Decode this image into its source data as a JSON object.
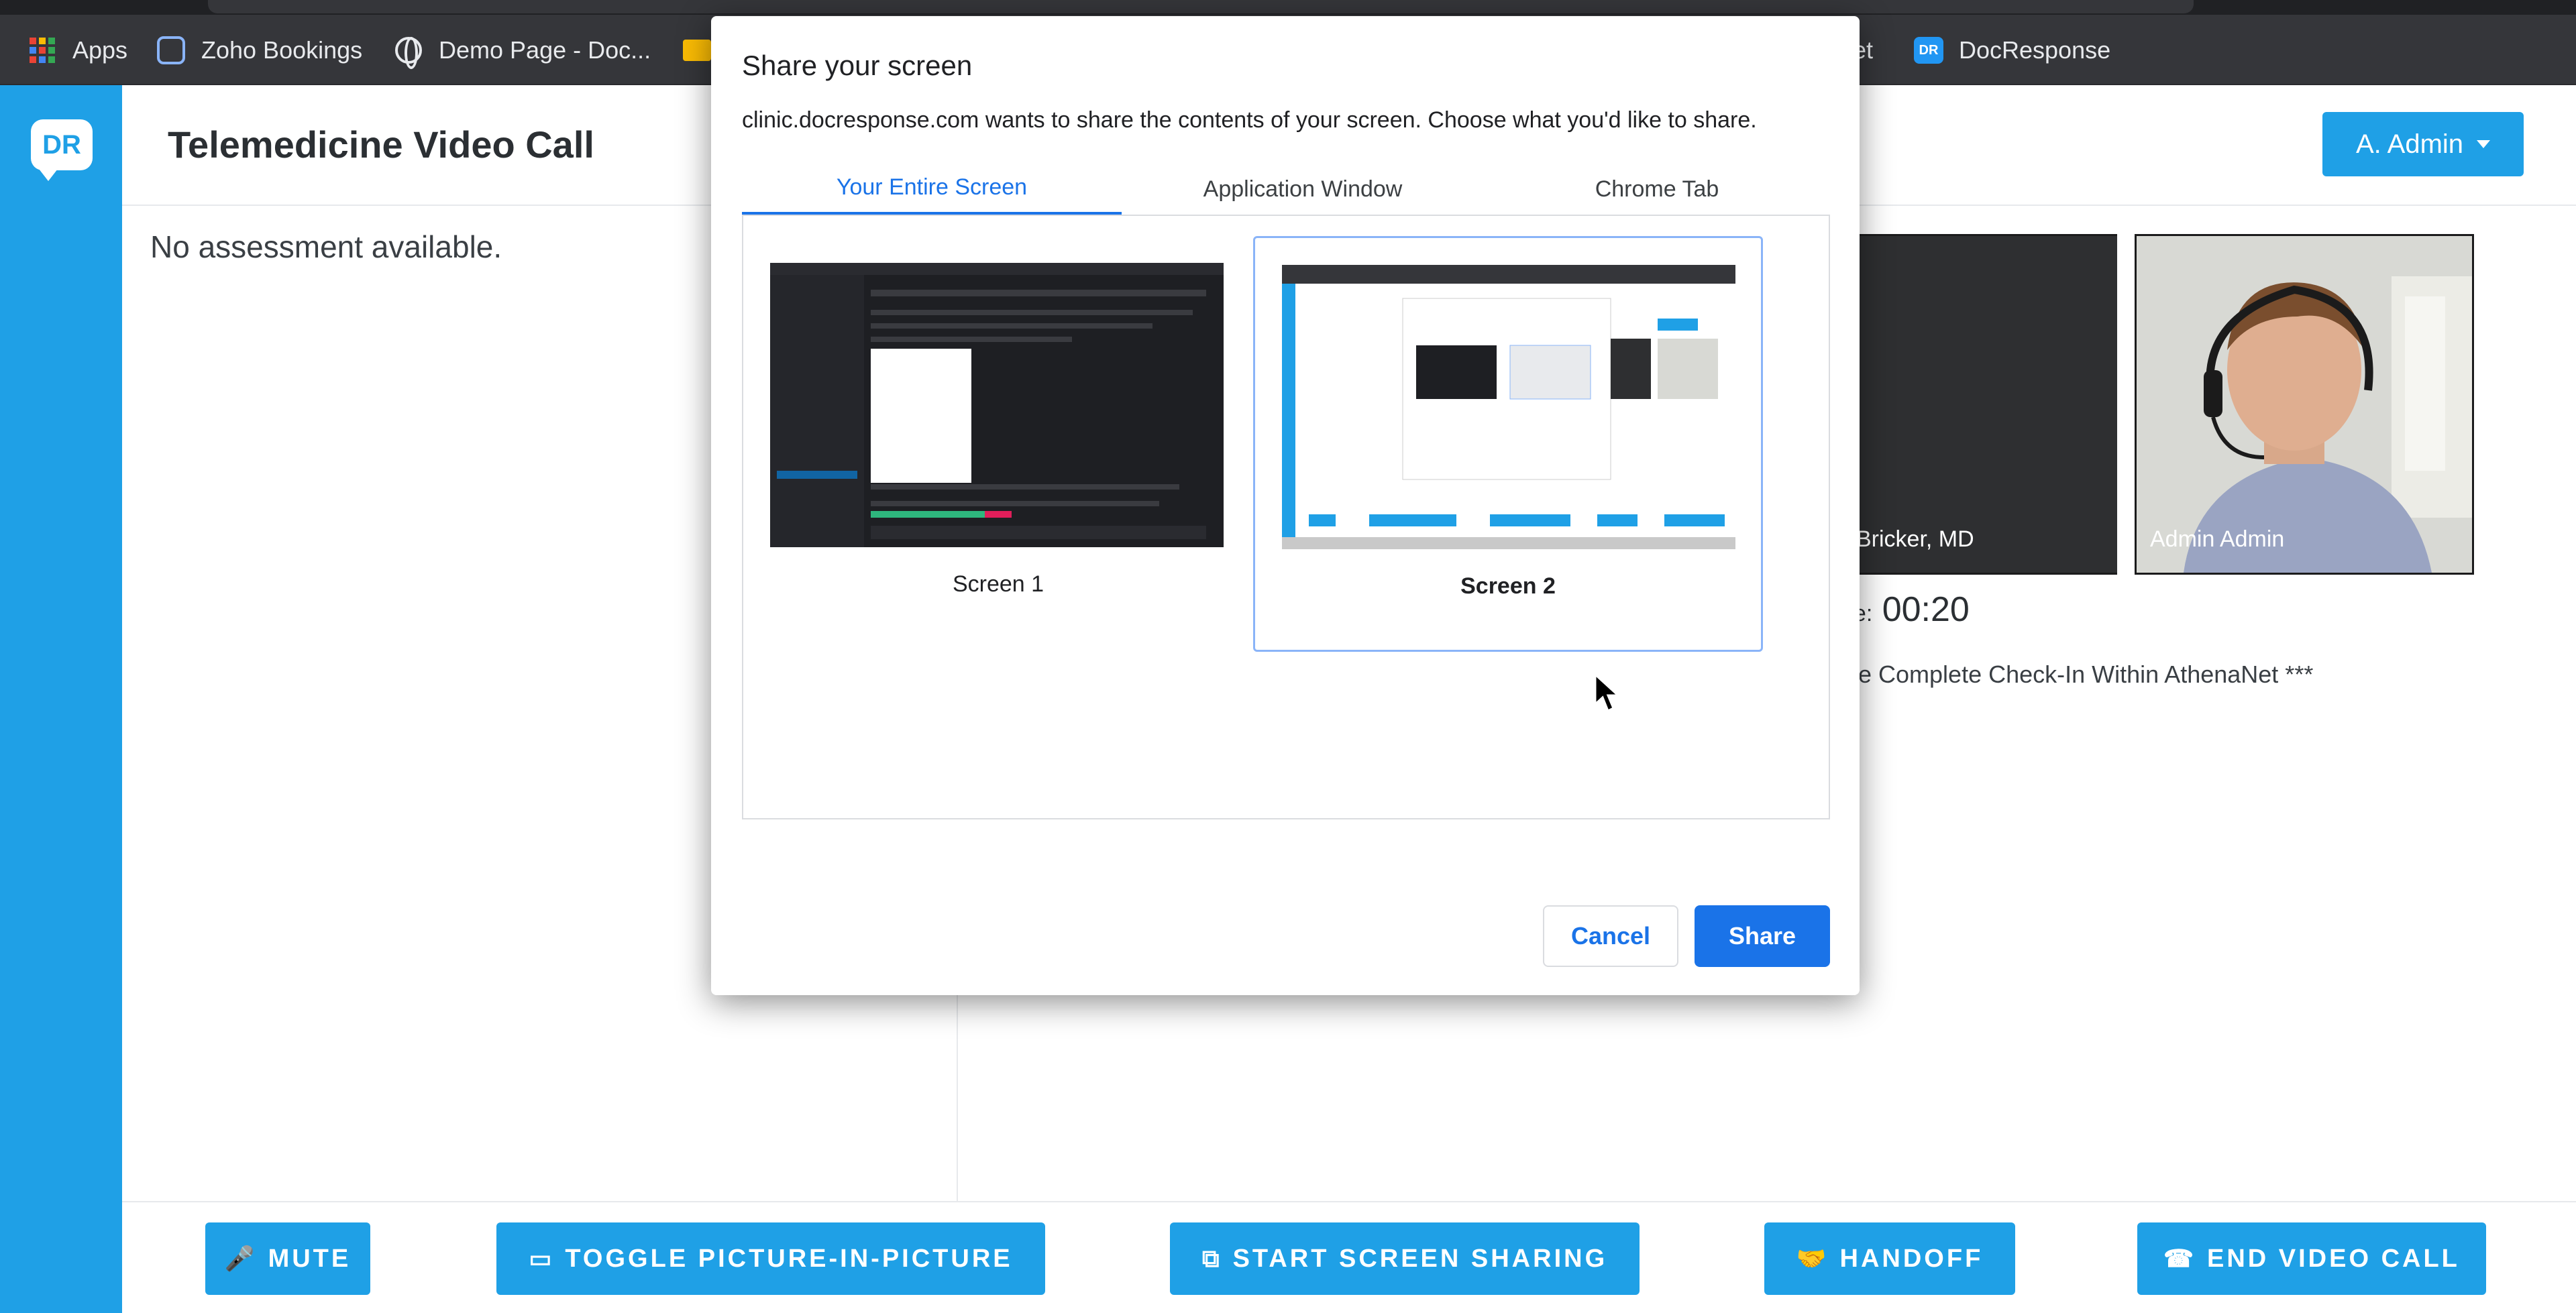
{
  "browser": {
    "bookmarks": [
      {
        "label": "Apps",
        "icon": "apps-grid-icon"
      },
      {
        "label": "Zoho Bookings",
        "icon": "zoho-icon"
      },
      {
        "label": "Demo Page - Doc...",
        "icon": "globe-icon"
      },
      {
        "label": "et",
        "icon": "folder-icon"
      },
      {
        "label": "DocResponse",
        "icon": "docresponse-icon"
      }
    ]
  },
  "app": {
    "logo_text": "DR",
    "title": "Telemedicine Video Call",
    "user_menu": "A. Admin",
    "assessment": "No assessment available.",
    "participants": [
      {
        "name": "Bricker, MD"
      },
      {
        "name": "Admin Admin"
      }
    ],
    "timer_label": "ne:",
    "timer_value": "00:20",
    "notice": "se Complete Check-In Within AthenaNet ***",
    "toolbar": [
      {
        "label": "MUTE",
        "icon": "microphone-icon",
        "glyph": "🎤"
      },
      {
        "label": "TOGGLE PICTURE-IN-PICTURE",
        "icon": "picture-in-picture-icon",
        "glyph": "▭"
      },
      {
        "label": "START SCREEN SHARING",
        "icon": "screen-share-icon",
        "glyph": "⧉"
      },
      {
        "label": "HANDOFF",
        "icon": "handshake-icon",
        "glyph": "🤝"
      },
      {
        "label": "END VIDEO CALL",
        "icon": "phone-icon",
        "glyph": "☎"
      }
    ]
  },
  "dialog": {
    "title": "Share your screen",
    "description": "clinic.docresponse.com wants to share the contents of your screen. Choose what you'd like to share.",
    "tabs": [
      {
        "label": "Your Entire Screen",
        "active": true
      },
      {
        "label": "Application Window",
        "active": false
      },
      {
        "label": "Chrome Tab",
        "active": false
      }
    ],
    "screens": [
      {
        "label": "Screen 1",
        "selected": false
      },
      {
        "label": "Screen 2",
        "selected": true
      }
    ],
    "cancel_label": "Cancel",
    "share_label": "Share"
  },
  "colors": {
    "brand": "#1fa0e6",
    "dialog_accent": "#1a73e8",
    "selection_border": "#8ab4f8"
  }
}
